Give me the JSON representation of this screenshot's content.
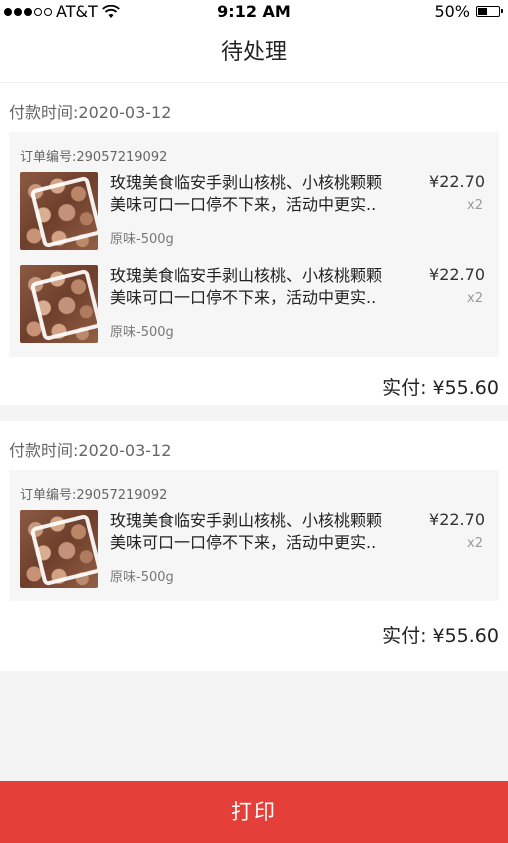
{
  "status_bar": {
    "carrier": "AT&T",
    "time": "9:12 AM",
    "battery_percent": "50%",
    "battery_level": 0.5,
    "signal_bars_filled": 3,
    "signal_bars_total": 5
  },
  "header": {
    "title": "待处理"
  },
  "orders": [
    {
      "pay_time": "付款时间:2020-03-12",
      "order_no": "订单编号:29057219092",
      "paid_total": "实付: ¥55.60",
      "items": [
        {
          "title": "玫瑰美食临安手剥山核桃、小核桃颗颗\n美味可口一口停不下来，活动中更实..",
          "spec": "原味-500g",
          "price": "¥22.70",
          "qty": "x2"
        },
        {
          "title": "玫瑰美食临安手剥山核桃、小核桃颗颗\n美味可口一口停不下来，活动中更实..",
          "spec": "原味-500g",
          "price": "¥22.70",
          "qty": "x2"
        }
      ]
    },
    {
      "pay_time": "付款时间:2020-03-12",
      "order_no": "订单编号:29057219092",
      "paid_total": "实付: ¥55.60",
      "items": [
        {
          "title": "玫瑰美食临安手剥山核桃、小核桃颗颗\n美味可口一口停不下来，活动中更实..",
          "spec": "原味-500g",
          "price": "¥22.70",
          "qty": "x2"
        }
      ]
    }
  ],
  "footer": {
    "print_label": "打印"
  }
}
